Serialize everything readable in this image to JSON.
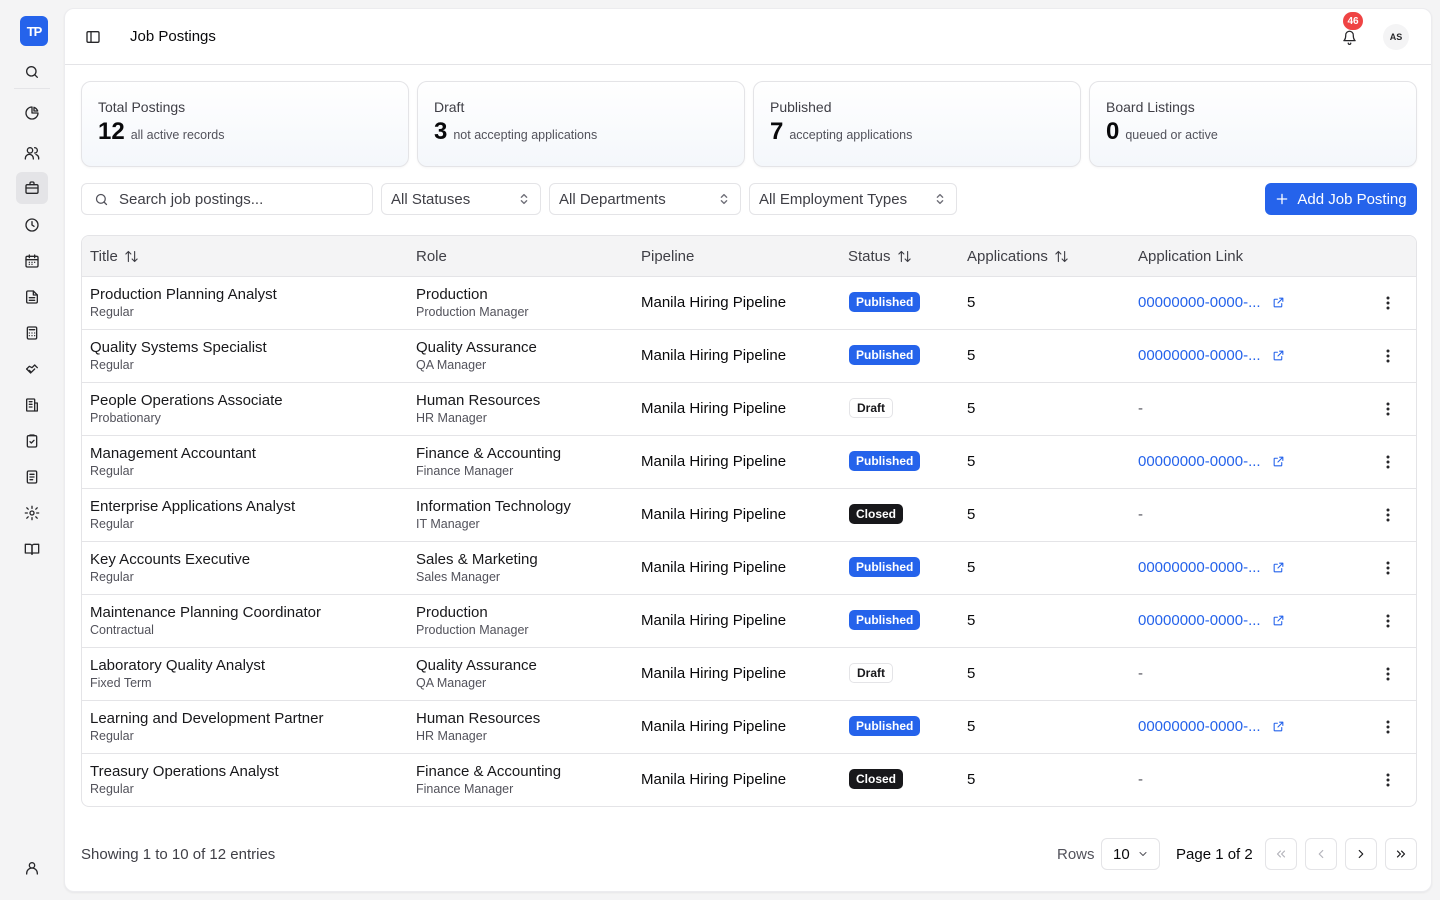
{
  "app": {
    "logo_text": "TP"
  },
  "header": {
    "title": "Job Postings",
    "notifications_count": "46",
    "avatar_initials": "AS"
  },
  "stats": [
    {
      "label": "Total Postings",
      "value": "12",
      "sub": "all active records"
    },
    {
      "label": "Draft",
      "value": "3",
      "sub": "not accepting applications"
    },
    {
      "label": "Published",
      "value": "7",
      "sub": "accepting applications"
    },
    {
      "label": "Board Listings",
      "value": "0",
      "sub": "queued or active"
    }
  ],
  "filters": {
    "search_placeholder": "Search job postings...",
    "status": "All Statuses",
    "department": "All Departments",
    "employment_type": "All Employment Types",
    "add_label": "Add Job Posting"
  },
  "table": {
    "columns": {
      "title": "Title",
      "role": "Role",
      "pipeline": "Pipeline",
      "status": "Status",
      "applications": "Applications",
      "link": "Application Link"
    },
    "rows": [
      {
        "title": "Production Planning Analyst",
        "type": "Regular",
        "department": "Production",
        "manager": "Production Manager",
        "pipeline": "Manila Hiring Pipeline",
        "status": "Published",
        "applications": "5",
        "link": "00000000-0000-..."
      },
      {
        "title": "Quality Systems Specialist",
        "type": "Regular",
        "department": "Quality Assurance",
        "manager": "QA Manager",
        "pipeline": "Manila Hiring Pipeline",
        "status": "Published",
        "applications": "5",
        "link": "00000000-0000-..."
      },
      {
        "title": "People Operations Associate",
        "type": "Probationary",
        "department": "Human Resources",
        "manager": "HR Manager",
        "pipeline": "Manila Hiring Pipeline",
        "status": "Draft",
        "applications": "5",
        "link": "-"
      },
      {
        "title": "Management Accountant",
        "type": "Regular",
        "department": "Finance & Accounting",
        "manager": "Finance Manager",
        "pipeline": "Manila Hiring Pipeline",
        "status": "Published",
        "applications": "5",
        "link": "00000000-0000-..."
      },
      {
        "title": "Enterprise Applications Analyst",
        "type": "Regular",
        "department": "Information Technology",
        "manager": "IT Manager",
        "pipeline": "Manila Hiring Pipeline",
        "status": "Closed",
        "applications": "5",
        "link": "-"
      },
      {
        "title": "Key Accounts Executive",
        "type": "Regular",
        "department": "Sales & Marketing",
        "manager": "Sales Manager",
        "pipeline": "Manila Hiring Pipeline",
        "status": "Published",
        "applications": "5",
        "link": "00000000-0000-..."
      },
      {
        "title": "Maintenance Planning Coordinator",
        "type": "Contractual",
        "department": "Production",
        "manager": "Production Manager",
        "pipeline": "Manila Hiring Pipeline",
        "status": "Published",
        "applications": "5",
        "link": "00000000-0000-..."
      },
      {
        "title": "Laboratory Quality Analyst",
        "type": "Fixed Term",
        "department": "Quality Assurance",
        "manager": "QA Manager",
        "pipeline": "Manila Hiring Pipeline",
        "status": "Draft",
        "applications": "5",
        "link": "-"
      },
      {
        "title": "Learning and Development Partner",
        "type": "Regular",
        "department": "Human Resources",
        "manager": "HR Manager",
        "pipeline": "Manila Hiring Pipeline",
        "status": "Published",
        "applications": "5",
        "link": "00000000-0000-..."
      },
      {
        "title": "Treasury Operations Analyst",
        "type": "Regular",
        "department": "Finance & Accounting",
        "manager": "Finance Manager",
        "pipeline": "Manila Hiring Pipeline",
        "status": "Closed",
        "applications": "5",
        "link": "-"
      }
    ]
  },
  "footer": {
    "showing": "Showing 1 to 10 of 12 entries",
    "rows_label": "Rows",
    "rows_value": "10",
    "page_info": "Page 1 of 2"
  },
  "colors": {
    "accent": "#2563eb",
    "badge_closed": "#18181b",
    "notification": "#ef4444"
  }
}
